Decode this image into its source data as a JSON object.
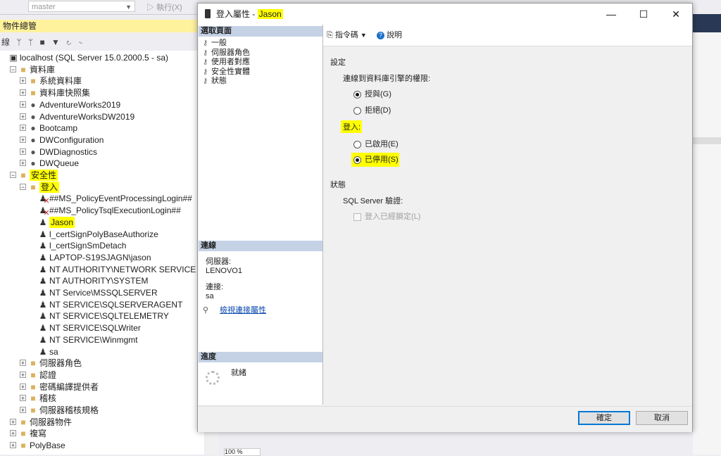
{
  "background": {
    "db_selector_value": "master",
    "execute_label": "執行(X)",
    "object_explorer_title": "物件總管",
    "connect_label": "線",
    "tree": [
      {
        "label": "localhost (SQL Server 15.0.2000.5 - sa)",
        "icon": "server-icon"
      },
      {
        "label": "資料庫",
        "icon": "folder-icon"
      },
      {
        "label": "系統資料庫",
        "icon": "folder-icon"
      },
      {
        "label": "資料庫快照集",
        "icon": "folder-icon"
      },
      {
        "label": "AdventureWorks2019",
        "icon": "database-icon"
      },
      {
        "label": "AdventureWorksDW2019",
        "icon": "database-icon"
      },
      {
        "label": "Bootcamp",
        "icon": "database-icon"
      },
      {
        "label": "DWConfiguration",
        "icon": "database-icon"
      },
      {
        "label": "DWDiagnostics",
        "icon": "database-icon"
      },
      {
        "label": "DWQueue",
        "icon": "database-icon"
      },
      {
        "label": "安全性",
        "icon": "folder-icon"
      },
      {
        "label": "登入",
        "icon": "folder-icon"
      },
      {
        "label": "##MS_PolicyEventProcessingLogin##",
        "icon": "disabled-user-icon"
      },
      {
        "label": "##MS_PolicyTsqlExecutionLogin##",
        "icon": "disabled-user-icon"
      },
      {
        "label": "Jason",
        "icon": "user-icon"
      },
      {
        "label": "l_certSignPolyBaseAuthorize",
        "icon": "user-icon"
      },
      {
        "label": "l_certSignSmDetach",
        "icon": "user-icon"
      },
      {
        "label": "LAPTOP-S19SJAGN\\jason",
        "icon": "user-icon"
      },
      {
        "label": "NT AUTHORITY\\NETWORK SERVICE",
        "icon": "user-icon"
      },
      {
        "label": "NT AUTHORITY\\SYSTEM",
        "icon": "user-icon"
      },
      {
        "label": "NT Service\\MSSQLSERVER",
        "icon": "user-icon"
      },
      {
        "label": "NT SERVICE\\SQLSERVERAGENT",
        "icon": "user-icon"
      },
      {
        "label": "NT SERVICE\\SQLTELEMETRY",
        "icon": "user-icon"
      },
      {
        "label": "NT SERVICE\\SQLWriter",
        "icon": "user-icon"
      },
      {
        "label": "NT SERVICE\\Winmgmt",
        "icon": "user-icon"
      },
      {
        "label": "sa",
        "icon": "user-icon"
      },
      {
        "label": "伺服器角色",
        "icon": "folder-icon"
      },
      {
        "label": "認證",
        "icon": "folder-icon"
      },
      {
        "label": "密碼編譯提供者",
        "icon": "folder-icon"
      },
      {
        "label": "稽核",
        "icon": "folder-icon"
      },
      {
        "label": "伺服器稽核規格",
        "icon": "folder-icon"
      },
      {
        "label": "伺服器物件",
        "icon": "folder-icon"
      },
      {
        "label": "複寫",
        "icon": "folder-icon"
      },
      {
        "label": "PolyBase",
        "icon": "folder-icon"
      }
    ],
    "zoom": "100 %"
  },
  "dialog": {
    "title_prefix": "登入屬性 - ",
    "title_name": "Jason",
    "select_page_header": "選取頁面",
    "pages": [
      "一般",
      "伺服器角色",
      "使用者對應",
      "安全性實體",
      "狀態"
    ],
    "connection_header": "連線",
    "server_label": "伺服器:",
    "server_value": "LENOVO1",
    "connection_label": "連接:",
    "connection_value": "sa",
    "view_connection_link": "檢視連接屬性",
    "progress_header": "進度",
    "progress_status": "就緒",
    "toolbar": {
      "script_label": "指令碼",
      "help_label": "說明"
    },
    "settings_label": "設定",
    "permission_label": "連線到資料庫引擎的權限:",
    "grant_label": "授與(G)",
    "deny_label": "拒絕(D)",
    "login_label": "登入:",
    "enabled_label": "已啟用(E)",
    "disabled_label": "已停用(S)",
    "status_label": "狀態",
    "sql_auth_label": "SQL Server 驗證:",
    "locked_label": "登入已經鎖定(L)",
    "ok_label": "確定",
    "cancel_label": "取消"
  }
}
